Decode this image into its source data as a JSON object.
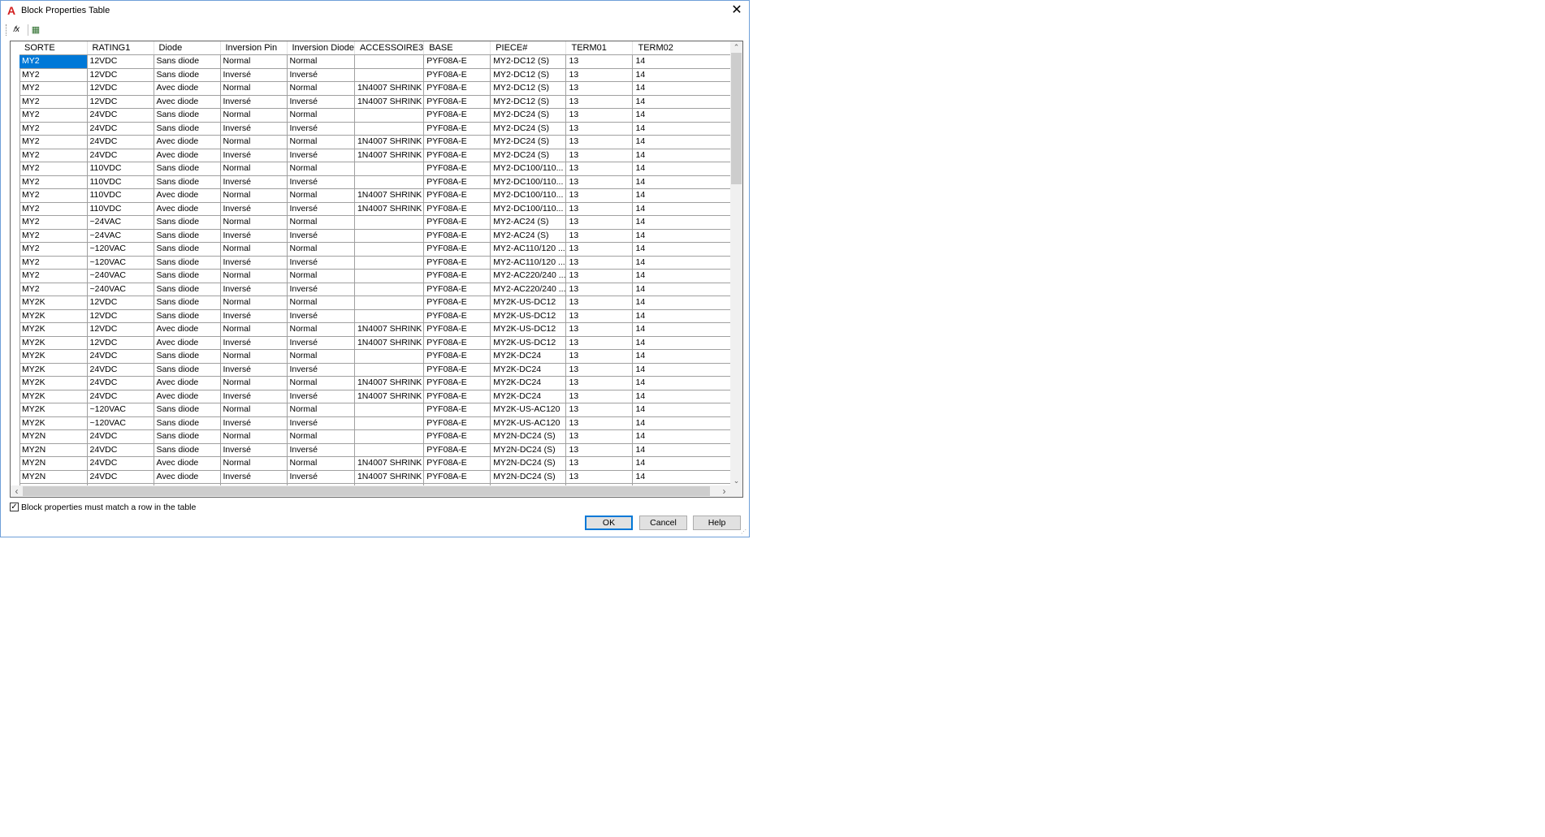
{
  "window": {
    "title": "Block Properties Table",
    "app_icon": "autocad-a-icon",
    "close_glyph": "✕"
  },
  "toolbar": {
    "buttons": [
      {
        "name": "formula-icon",
        "glyph": "𝑓x"
      },
      {
        "name": "table-settings-icon",
        "glyph": "▦"
      }
    ]
  },
  "table": {
    "columns": [
      "SORTE",
      "RATING1",
      "Diode",
      "Inversion Pin",
      "Inversion Diode",
      "ACCESSOIRE3",
      "BASE",
      "PIECE#",
      "TERM01",
      "TERM02"
    ],
    "rows": [
      [
        "MY2",
        "12VDC",
        "Sans diode",
        "Normal",
        "Normal",
        "",
        "PYF08A-E",
        "MY2-DC12 (S)",
        "13",
        "14"
      ],
      [
        "MY2",
        "12VDC",
        "Sans diode",
        "Inversé",
        "Inversé",
        "",
        "PYF08A-E",
        "MY2-DC12 (S)",
        "13",
        "14"
      ],
      [
        "MY2",
        "12VDC",
        "Avec diode",
        "Normal",
        "Normal",
        "1N4007 SHRINK",
        "PYF08A-E",
        "MY2-DC12 (S)",
        "13",
        "14"
      ],
      [
        "MY2",
        "12VDC",
        "Avec diode",
        "Inversé",
        "Inversé",
        "1N4007 SHRINK",
        "PYF08A-E",
        "MY2-DC12 (S)",
        "13",
        "14"
      ],
      [
        "MY2",
        "24VDC",
        "Sans diode",
        "Normal",
        "Normal",
        "",
        "PYF08A-E",
        "MY2-DC24 (S)",
        "13",
        "14"
      ],
      [
        "MY2",
        "24VDC",
        "Sans diode",
        "Inversé",
        "Inversé",
        "",
        "PYF08A-E",
        "MY2-DC24 (S)",
        "13",
        "14"
      ],
      [
        "MY2",
        "24VDC",
        "Avec diode",
        "Normal",
        "Normal",
        "1N4007 SHRINK",
        "PYF08A-E",
        "MY2-DC24 (S)",
        "13",
        "14"
      ],
      [
        "MY2",
        "24VDC",
        "Avec diode",
        "Inversé",
        "Inversé",
        "1N4007 SHRINK",
        "PYF08A-E",
        "MY2-DC24 (S)",
        "13",
        "14"
      ],
      [
        "MY2",
        "110VDC",
        "Sans diode",
        "Normal",
        "Normal",
        "",
        "PYF08A-E",
        "MY2-DC100/110...",
        "13",
        "14"
      ],
      [
        "MY2",
        "110VDC",
        "Sans diode",
        "Inversé",
        "Inversé",
        "",
        "PYF08A-E",
        "MY2-DC100/110...",
        "13",
        "14"
      ],
      [
        "MY2",
        "110VDC",
        "Avec diode",
        "Normal",
        "Normal",
        "1N4007 SHRINK",
        "PYF08A-E",
        "MY2-DC100/110...",
        "13",
        "14"
      ],
      [
        "MY2",
        "110VDC",
        "Avec diode",
        "Inversé",
        "Inversé",
        "1N4007 SHRINK",
        "PYF08A-E",
        "MY2-DC100/110...",
        "13",
        "14"
      ],
      [
        "MY2",
        "~24VAC",
        "Sans diode",
        "Normal",
        "Normal",
        "",
        "PYF08A-E",
        "MY2-AC24 (S)",
        "13",
        "14"
      ],
      [
        "MY2",
        "~24VAC",
        "Sans diode",
        "Inversé",
        "Inversé",
        "",
        "PYF08A-E",
        "MY2-AC24 (S)",
        "13",
        "14"
      ],
      [
        "MY2",
        "~120VAC",
        "Sans diode",
        "Normal",
        "Normal",
        "",
        "PYF08A-E",
        "MY2-AC110/120 ...",
        "13",
        "14"
      ],
      [
        "MY2",
        "~120VAC",
        "Sans diode",
        "Inversé",
        "Inversé",
        "",
        "PYF08A-E",
        "MY2-AC110/120 ...",
        "13",
        "14"
      ],
      [
        "MY2",
        "~240VAC",
        "Sans diode",
        "Normal",
        "Normal",
        "",
        "PYF08A-E",
        "MY2-AC220/240 ...",
        "13",
        "14"
      ],
      [
        "MY2",
        "~240VAC",
        "Sans diode",
        "Inversé",
        "Inversé",
        "",
        "PYF08A-E",
        "MY2-AC220/240 ...",
        "13",
        "14"
      ],
      [
        "MY2K",
        "12VDC",
        "Sans diode",
        "Normal",
        "Normal",
        "",
        "PYF08A-E",
        "MY2K-US-DC12",
        "13",
        "14"
      ],
      [
        "MY2K",
        "12VDC",
        "Sans diode",
        "Inversé",
        "Inversé",
        "",
        "PYF08A-E",
        "MY2K-US-DC12",
        "13",
        "14"
      ],
      [
        "MY2K",
        "12VDC",
        "Avec diode",
        "Normal",
        "Normal",
        "1N4007 SHRINK",
        "PYF08A-E",
        "MY2K-US-DC12",
        "13",
        "14"
      ],
      [
        "MY2K",
        "12VDC",
        "Avec diode",
        "Inversé",
        "Inversé",
        "1N4007 SHRINK",
        "PYF08A-E",
        "MY2K-US-DC12",
        "13",
        "14"
      ],
      [
        "MY2K",
        "24VDC",
        "Sans diode",
        "Normal",
        "Normal",
        "",
        "PYF08A-E",
        "MY2K-DC24",
        "13",
        "14"
      ],
      [
        "MY2K",
        "24VDC",
        "Sans diode",
        "Inversé",
        "Inversé",
        "",
        "PYF08A-E",
        "MY2K-DC24",
        "13",
        "14"
      ],
      [
        "MY2K",
        "24VDC",
        "Avec diode",
        "Normal",
        "Normal",
        "1N4007 SHRINK",
        "PYF08A-E",
        "MY2K-DC24",
        "13",
        "14"
      ],
      [
        "MY2K",
        "24VDC",
        "Avec diode",
        "Inversé",
        "Inversé",
        "1N4007 SHRINK",
        "PYF08A-E",
        "MY2K-DC24",
        "13",
        "14"
      ],
      [
        "MY2K",
        "~120VAC",
        "Sans diode",
        "Normal",
        "Normal",
        "",
        "PYF08A-E",
        "MY2K-US-AC120",
        "13",
        "14"
      ],
      [
        "MY2K",
        "~120VAC",
        "Sans diode",
        "Inversé",
        "Inversé",
        "",
        "PYF08A-E",
        "MY2K-US-AC120",
        "13",
        "14"
      ],
      [
        "MY2N",
        "24VDC",
        "Sans diode",
        "Normal",
        "Normal",
        "",
        "PYF08A-E",
        "MY2N-DC24 (S)",
        "13",
        "14"
      ],
      [
        "MY2N",
        "24VDC",
        "Sans diode",
        "Inversé",
        "Inversé",
        "",
        "PYF08A-E",
        "MY2N-DC24 (S)",
        "13",
        "14"
      ],
      [
        "MY2N",
        "24VDC",
        "Avec diode",
        "Normal",
        "Normal",
        "1N4007 SHRINK",
        "PYF08A-E",
        "MY2N-DC24 (S)",
        "13",
        "14"
      ],
      [
        "MY2N",
        "24VDC",
        "Avec diode",
        "Inversé",
        "Inversé",
        "1N4007 SHRINK",
        "PYF08A-E",
        "MY2N-DC24 (S)",
        "13",
        "14"
      ],
      [
        "",
        "",
        "",
        "",
        "",
        "",
        "",
        "",
        "",
        ""
      ]
    ],
    "selected_cell": {
      "row": 0,
      "col": 0
    }
  },
  "scrollbars": {
    "up": "⌃",
    "down": "⌄",
    "left": "‹",
    "right": "›"
  },
  "footer": {
    "checkbox_checked": true,
    "checkbox_glyph": "✓",
    "checkbox_label": "Block properties must match a row in the table",
    "ok_label": "OK",
    "cancel_label": "Cancel",
    "help_label": "Help"
  },
  "colors": {
    "selection": "#0078d7",
    "window_border": "#6f9fd8",
    "app_icon": "#d21f1f"
  }
}
